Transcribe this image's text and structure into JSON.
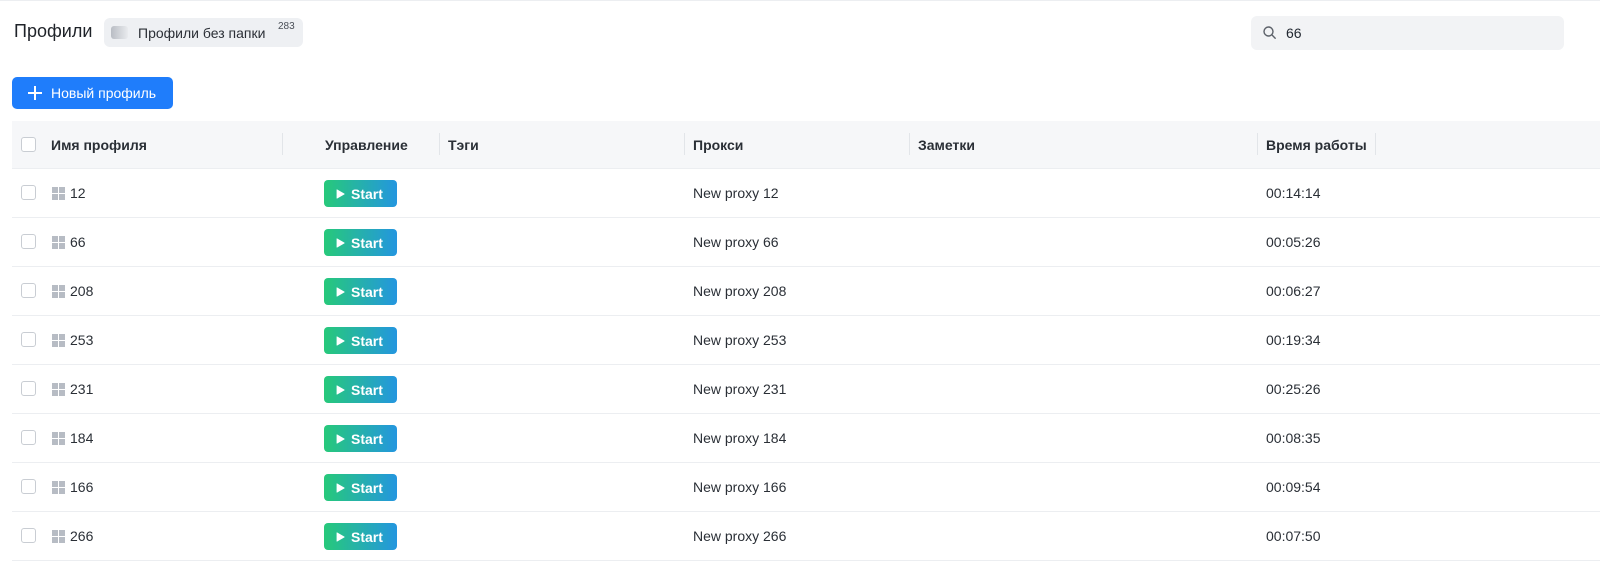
{
  "header": {
    "title": "Профили",
    "folder_chip": {
      "label": "Профили без папки",
      "count": "283"
    },
    "search": {
      "value": "66",
      "icon": "search-icon"
    }
  },
  "toolbar": {
    "new_profile_label": "Новый профиль"
  },
  "table": {
    "columns": {
      "name": "Имя профиля",
      "control": "Управление",
      "tags": "Тэги",
      "proxy": "Прокси",
      "notes": "Заметки",
      "uptime": "Время работы"
    },
    "rows": [
      {
        "name": "12",
        "action": "Start",
        "proxy": "New proxy 12",
        "uptime": "00:14:14"
      },
      {
        "name": "66",
        "action": "Start",
        "proxy": "New proxy 66",
        "uptime": "00:05:26"
      },
      {
        "name": "208",
        "action": "Start",
        "proxy": "New proxy 208",
        "uptime": "00:06:27"
      },
      {
        "name": "253",
        "action": "Start",
        "proxy": "New proxy 253",
        "uptime": "00:19:34"
      },
      {
        "name": "231",
        "action": "Start",
        "proxy": "New proxy 231",
        "uptime": "00:25:26"
      },
      {
        "name": "184",
        "action": "Start",
        "proxy": "New proxy 184",
        "uptime": "00:08:35"
      },
      {
        "name": "166",
        "action": "Start",
        "proxy": "New proxy 166",
        "uptime": "00:09:54"
      },
      {
        "name": "266",
        "action": "Start",
        "proxy": "New proxy 266",
        "uptime": "00:07:50"
      }
    ]
  },
  "colors": {
    "primary": "#1f7dfb",
    "start_gradient_from": "#27c97a",
    "start_gradient_to": "#2496df"
  }
}
